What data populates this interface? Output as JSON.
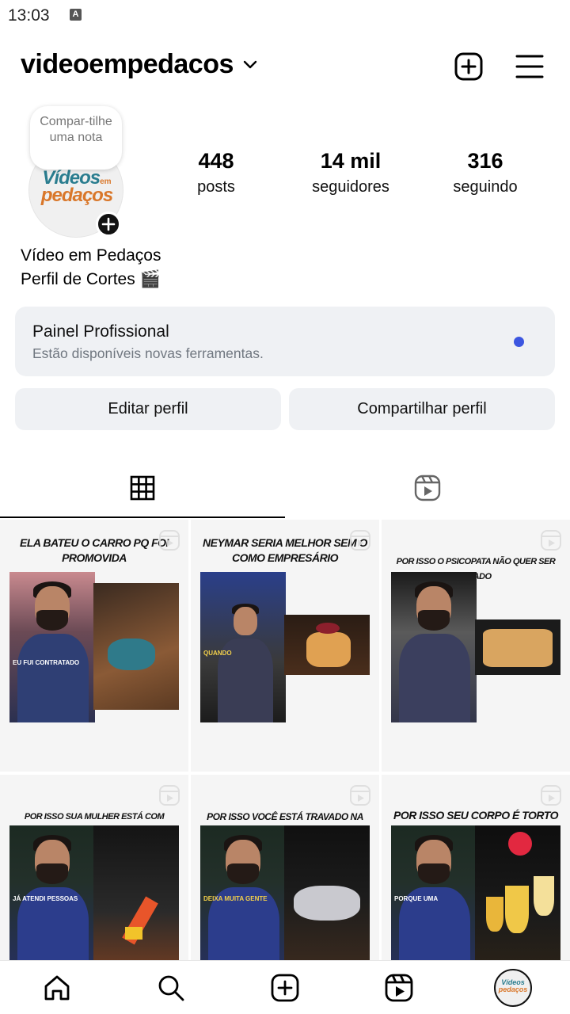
{
  "status_bar": {
    "time": "13:03",
    "indicator": "A"
  },
  "header": {
    "username": "videoempedacos"
  },
  "note": {
    "text": "Compar-tilhe uma nota"
  },
  "avatar": {
    "logo_line1": "Vídeos",
    "logo_small": "em",
    "logo_line2": "pedaços"
  },
  "stats": [
    {
      "value": "448",
      "label": "posts"
    },
    {
      "value": "14 mil",
      "label": "seguidores"
    },
    {
      "value": "316",
      "label": "seguindo"
    }
  ],
  "profile": {
    "name": "Vídeo em Pedaços",
    "bio": "Perfil de Cortes 🎬"
  },
  "panel": {
    "title": "Painel Profissional",
    "subtitle": "Estão disponíveis novas ferramentas."
  },
  "buttons": {
    "edit": "Editar perfil",
    "share": "Compartilhar perfil"
  },
  "posts": [
    {
      "title": "ELA BATEU O CARRO PQ FOI PROMOVIDA",
      "caption": "EU FUI CONTRATADO"
    },
    {
      "title": "NEYMAR SERIA MELHOR SEM O COMO EMPRESÁRIO",
      "caption": "QUANDO"
    },
    {
      "title": "POR ISSO O PSICOPATA NÃO QUER SER AMADO",
      "caption": ""
    },
    {
      "title": "POR ISSO SUA MULHER ESTÁ COM SOBREPESO",
      "caption": "JÁ ATENDI PESSOAS"
    },
    {
      "title": "POR ISSO VOCÊ ESTÁ TRAVADO NA VIDA",
      "caption": "DEIXA MUITA GENTE"
    },
    {
      "title": "POR ISSO SEU CORPO É TORTO",
      "caption": "PORQUE UMA"
    }
  ],
  "icons": {
    "header": [
      "chevron-down-icon",
      "add-content-icon",
      "menu-icon"
    ],
    "tabs": [
      "grid-icon",
      "reels-icon"
    ],
    "nav": [
      "home-icon",
      "search-icon",
      "create-icon",
      "reels-icon",
      "profile-avatar"
    ]
  },
  "colors": {
    "panel_bg": "#eff1f4",
    "notification_dot": "#3c56e0",
    "button_bg": "#eff1f4"
  }
}
